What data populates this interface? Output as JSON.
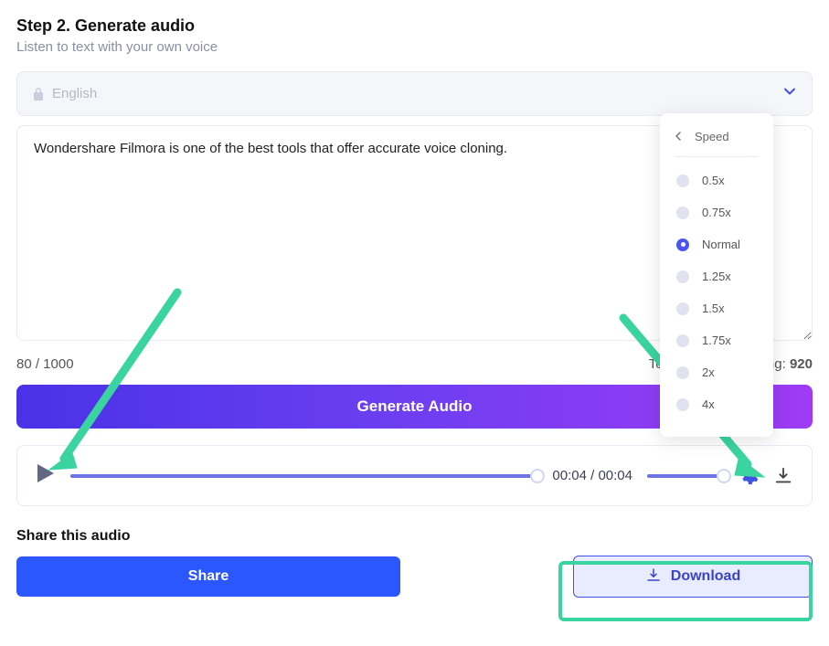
{
  "header": {
    "title": "Step 2. Generate audio",
    "subtitle": "Listen to text with your own voice"
  },
  "language": {
    "value": "English"
  },
  "textarea": {
    "value": "Wondershare Filmora is one of the best tools that offer accurate voice cloning."
  },
  "counter": {
    "used": "80 / 1000",
    "remaining_label": "Total words remaining:",
    "remaining_value": "920"
  },
  "generate": {
    "label": "Generate Audio"
  },
  "player": {
    "current": "00:04",
    "sep": "/",
    "duration": "00:04"
  },
  "speed": {
    "title": "Speed",
    "options": [
      "0.5x",
      "0.75x",
      "Normal",
      "1.25x",
      "1.5x",
      "1.75x",
      "2x",
      "4x"
    ],
    "selected_index": 2
  },
  "share": {
    "title": "Share this audio",
    "share_btn": "Share",
    "download_btn": "Download"
  },
  "colors": {
    "accent": "#4052e6",
    "highlight": "#3ad4a0"
  }
}
